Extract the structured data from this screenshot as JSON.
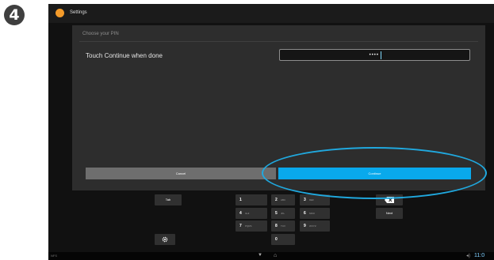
{
  "step_badge": "4",
  "app_bar": {
    "title": "Settings",
    "icon": "app-icon"
  },
  "dialog": {
    "title": "Choose your PIN",
    "prompt": "Touch Continue when done",
    "pin_masked": "••••",
    "cancel_label": "Cancel",
    "continue_label": "Continue"
  },
  "keyboard": {
    "tab_label": "Tab",
    "next_label": "Next",
    "backspace_icon": "backspace-icon",
    "settings_icon": "gear-icon",
    "keys": [
      {
        "digit": "1",
        "letters": ""
      },
      {
        "digit": "2",
        "letters": "ABC"
      },
      {
        "digit": "3",
        "letters": "DEF"
      },
      {
        "digit": "4",
        "letters": "GHI"
      },
      {
        "digit": "5",
        "letters": "JKL"
      },
      {
        "digit": "6",
        "letters": "MNO"
      },
      {
        "digit": "7",
        "letters": "PQRS"
      },
      {
        "digit": "8",
        "letters": "TUV"
      },
      {
        "digit": "9",
        "letters": "WXYZ"
      },
      {
        "digit": "0",
        "letters": ""
      }
    ]
  },
  "nav_bar": {
    "left_label": "NFS",
    "time": "11:0",
    "volume_icon": "volume-icon",
    "back_icon": "back-icon",
    "home_icon": "home-icon"
  },
  "colors": {
    "accent": "#09a9ec",
    "dialog_bg": "#2d2d2d",
    "screen_bg": "#111111",
    "highlight": "#20a8de",
    "app_icon": "#f49b2a"
  }
}
